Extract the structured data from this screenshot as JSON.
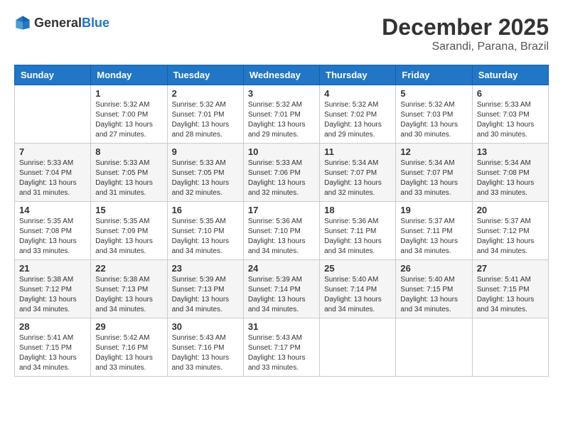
{
  "header": {
    "logo_general": "General",
    "logo_blue": "Blue",
    "month_title": "December 2025",
    "location": "Sarandi, Parana, Brazil"
  },
  "days_of_week": [
    "Sunday",
    "Monday",
    "Tuesday",
    "Wednesday",
    "Thursday",
    "Friday",
    "Saturday"
  ],
  "weeks": [
    [
      {
        "day": "",
        "sunrise": "",
        "sunset": "",
        "daylight": ""
      },
      {
        "day": "1",
        "sunrise": "Sunrise: 5:32 AM",
        "sunset": "Sunset: 7:00 PM",
        "daylight": "Daylight: 13 hours and 27 minutes."
      },
      {
        "day": "2",
        "sunrise": "Sunrise: 5:32 AM",
        "sunset": "Sunset: 7:01 PM",
        "daylight": "Daylight: 13 hours and 28 minutes."
      },
      {
        "day": "3",
        "sunrise": "Sunrise: 5:32 AM",
        "sunset": "Sunset: 7:01 PM",
        "daylight": "Daylight: 13 hours and 29 minutes."
      },
      {
        "day": "4",
        "sunrise": "Sunrise: 5:32 AM",
        "sunset": "Sunset: 7:02 PM",
        "daylight": "Daylight: 13 hours and 29 minutes."
      },
      {
        "day": "5",
        "sunrise": "Sunrise: 5:32 AM",
        "sunset": "Sunset: 7:03 PM",
        "daylight": "Daylight: 13 hours and 30 minutes."
      },
      {
        "day": "6",
        "sunrise": "Sunrise: 5:33 AM",
        "sunset": "Sunset: 7:03 PM",
        "daylight": "Daylight: 13 hours and 30 minutes."
      }
    ],
    [
      {
        "day": "7",
        "sunrise": "Sunrise: 5:33 AM",
        "sunset": "Sunset: 7:04 PM",
        "daylight": "Daylight: 13 hours and 31 minutes."
      },
      {
        "day": "8",
        "sunrise": "Sunrise: 5:33 AM",
        "sunset": "Sunset: 7:05 PM",
        "daylight": "Daylight: 13 hours and 31 minutes."
      },
      {
        "day": "9",
        "sunrise": "Sunrise: 5:33 AM",
        "sunset": "Sunset: 7:05 PM",
        "daylight": "Daylight: 13 hours and 32 minutes."
      },
      {
        "day": "10",
        "sunrise": "Sunrise: 5:33 AM",
        "sunset": "Sunset: 7:06 PM",
        "daylight": "Daylight: 13 hours and 32 minutes."
      },
      {
        "day": "11",
        "sunrise": "Sunrise: 5:34 AM",
        "sunset": "Sunset: 7:07 PM",
        "daylight": "Daylight: 13 hours and 32 minutes."
      },
      {
        "day": "12",
        "sunrise": "Sunrise: 5:34 AM",
        "sunset": "Sunset: 7:07 PM",
        "daylight": "Daylight: 13 hours and 33 minutes."
      },
      {
        "day": "13",
        "sunrise": "Sunrise: 5:34 AM",
        "sunset": "Sunset: 7:08 PM",
        "daylight": "Daylight: 13 hours and 33 minutes."
      }
    ],
    [
      {
        "day": "14",
        "sunrise": "Sunrise: 5:35 AM",
        "sunset": "Sunset: 7:08 PM",
        "daylight": "Daylight: 13 hours and 33 minutes."
      },
      {
        "day": "15",
        "sunrise": "Sunrise: 5:35 AM",
        "sunset": "Sunset: 7:09 PM",
        "daylight": "Daylight: 13 hours and 34 minutes."
      },
      {
        "day": "16",
        "sunrise": "Sunrise: 5:35 AM",
        "sunset": "Sunset: 7:10 PM",
        "daylight": "Daylight: 13 hours and 34 minutes."
      },
      {
        "day": "17",
        "sunrise": "Sunrise: 5:36 AM",
        "sunset": "Sunset: 7:10 PM",
        "daylight": "Daylight: 13 hours and 34 minutes."
      },
      {
        "day": "18",
        "sunrise": "Sunrise: 5:36 AM",
        "sunset": "Sunset: 7:11 PM",
        "daylight": "Daylight: 13 hours and 34 minutes."
      },
      {
        "day": "19",
        "sunrise": "Sunrise: 5:37 AM",
        "sunset": "Sunset: 7:11 PM",
        "daylight": "Daylight: 13 hours and 34 minutes."
      },
      {
        "day": "20",
        "sunrise": "Sunrise: 5:37 AM",
        "sunset": "Sunset: 7:12 PM",
        "daylight": "Daylight: 13 hours and 34 minutes."
      }
    ],
    [
      {
        "day": "21",
        "sunrise": "Sunrise: 5:38 AM",
        "sunset": "Sunset: 7:12 PM",
        "daylight": "Daylight: 13 hours and 34 minutes."
      },
      {
        "day": "22",
        "sunrise": "Sunrise: 5:38 AM",
        "sunset": "Sunset: 7:13 PM",
        "daylight": "Daylight: 13 hours and 34 minutes."
      },
      {
        "day": "23",
        "sunrise": "Sunrise: 5:39 AM",
        "sunset": "Sunset: 7:13 PM",
        "daylight": "Daylight: 13 hours and 34 minutes."
      },
      {
        "day": "24",
        "sunrise": "Sunrise: 5:39 AM",
        "sunset": "Sunset: 7:14 PM",
        "daylight": "Daylight: 13 hours and 34 minutes."
      },
      {
        "day": "25",
        "sunrise": "Sunrise: 5:40 AM",
        "sunset": "Sunset: 7:14 PM",
        "daylight": "Daylight: 13 hours and 34 minutes."
      },
      {
        "day": "26",
        "sunrise": "Sunrise: 5:40 AM",
        "sunset": "Sunset: 7:15 PM",
        "daylight": "Daylight: 13 hours and 34 minutes."
      },
      {
        "day": "27",
        "sunrise": "Sunrise: 5:41 AM",
        "sunset": "Sunset: 7:15 PM",
        "daylight": "Daylight: 13 hours and 34 minutes."
      }
    ],
    [
      {
        "day": "28",
        "sunrise": "Sunrise: 5:41 AM",
        "sunset": "Sunset: 7:15 PM",
        "daylight": "Daylight: 13 hours and 34 minutes."
      },
      {
        "day": "29",
        "sunrise": "Sunrise: 5:42 AM",
        "sunset": "Sunset: 7:16 PM",
        "daylight": "Daylight: 13 hours and 33 minutes."
      },
      {
        "day": "30",
        "sunrise": "Sunrise: 5:43 AM",
        "sunset": "Sunset: 7:16 PM",
        "daylight": "Daylight: 13 hours and 33 minutes."
      },
      {
        "day": "31",
        "sunrise": "Sunrise: 5:43 AM",
        "sunset": "Sunset: 7:17 PM",
        "daylight": "Daylight: 13 hours and 33 minutes."
      },
      {
        "day": "",
        "sunrise": "",
        "sunset": "",
        "daylight": ""
      },
      {
        "day": "",
        "sunrise": "",
        "sunset": "",
        "daylight": ""
      },
      {
        "day": "",
        "sunrise": "",
        "sunset": "",
        "daylight": ""
      }
    ]
  ]
}
